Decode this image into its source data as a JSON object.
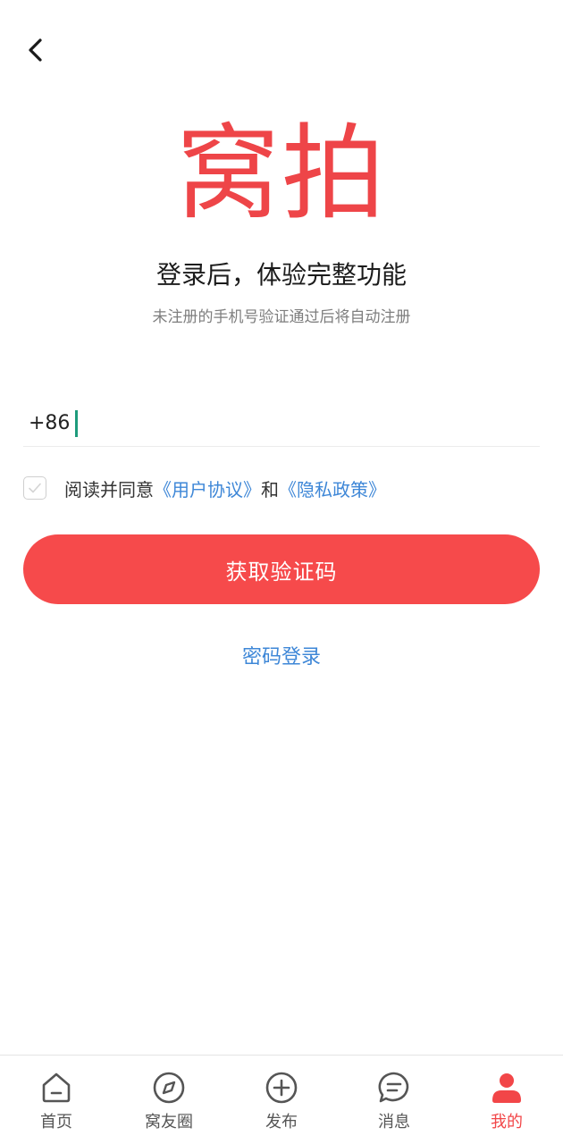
{
  "header": {
    "back_icon": "chevron-left-icon"
  },
  "brand": {
    "logo_text": "窝拍",
    "color": "#ee4548"
  },
  "intro": {
    "headline": "登录后，体验完整功能",
    "subline": "未注册的手机号验证通过后将自动注册"
  },
  "phone": {
    "country_code": "+86",
    "value": "",
    "placeholder": ""
  },
  "agreement": {
    "checked": false,
    "prefix": "阅读并同意",
    "user_agreement": "《用户协议》",
    "and": "和",
    "privacy_policy": "《隐私政策》"
  },
  "actions": {
    "get_code_label": "获取验证码",
    "password_login_label": "密码登录"
  },
  "colors": {
    "accent": "#f64a4b",
    "link": "#3e87d7",
    "caret": "#1e9b7c"
  },
  "tabbar": {
    "active": "mine",
    "items": [
      {
        "key": "home",
        "label": "首页",
        "icon": "home-icon"
      },
      {
        "key": "circle",
        "label": "窝友圈",
        "icon": "compass-icon"
      },
      {
        "key": "publish",
        "label": "发布",
        "icon": "plus-circle-icon"
      },
      {
        "key": "messages",
        "label": "消息",
        "icon": "chat-bubble-icon"
      },
      {
        "key": "mine",
        "label": "我的",
        "icon": "user-icon"
      }
    ]
  }
}
